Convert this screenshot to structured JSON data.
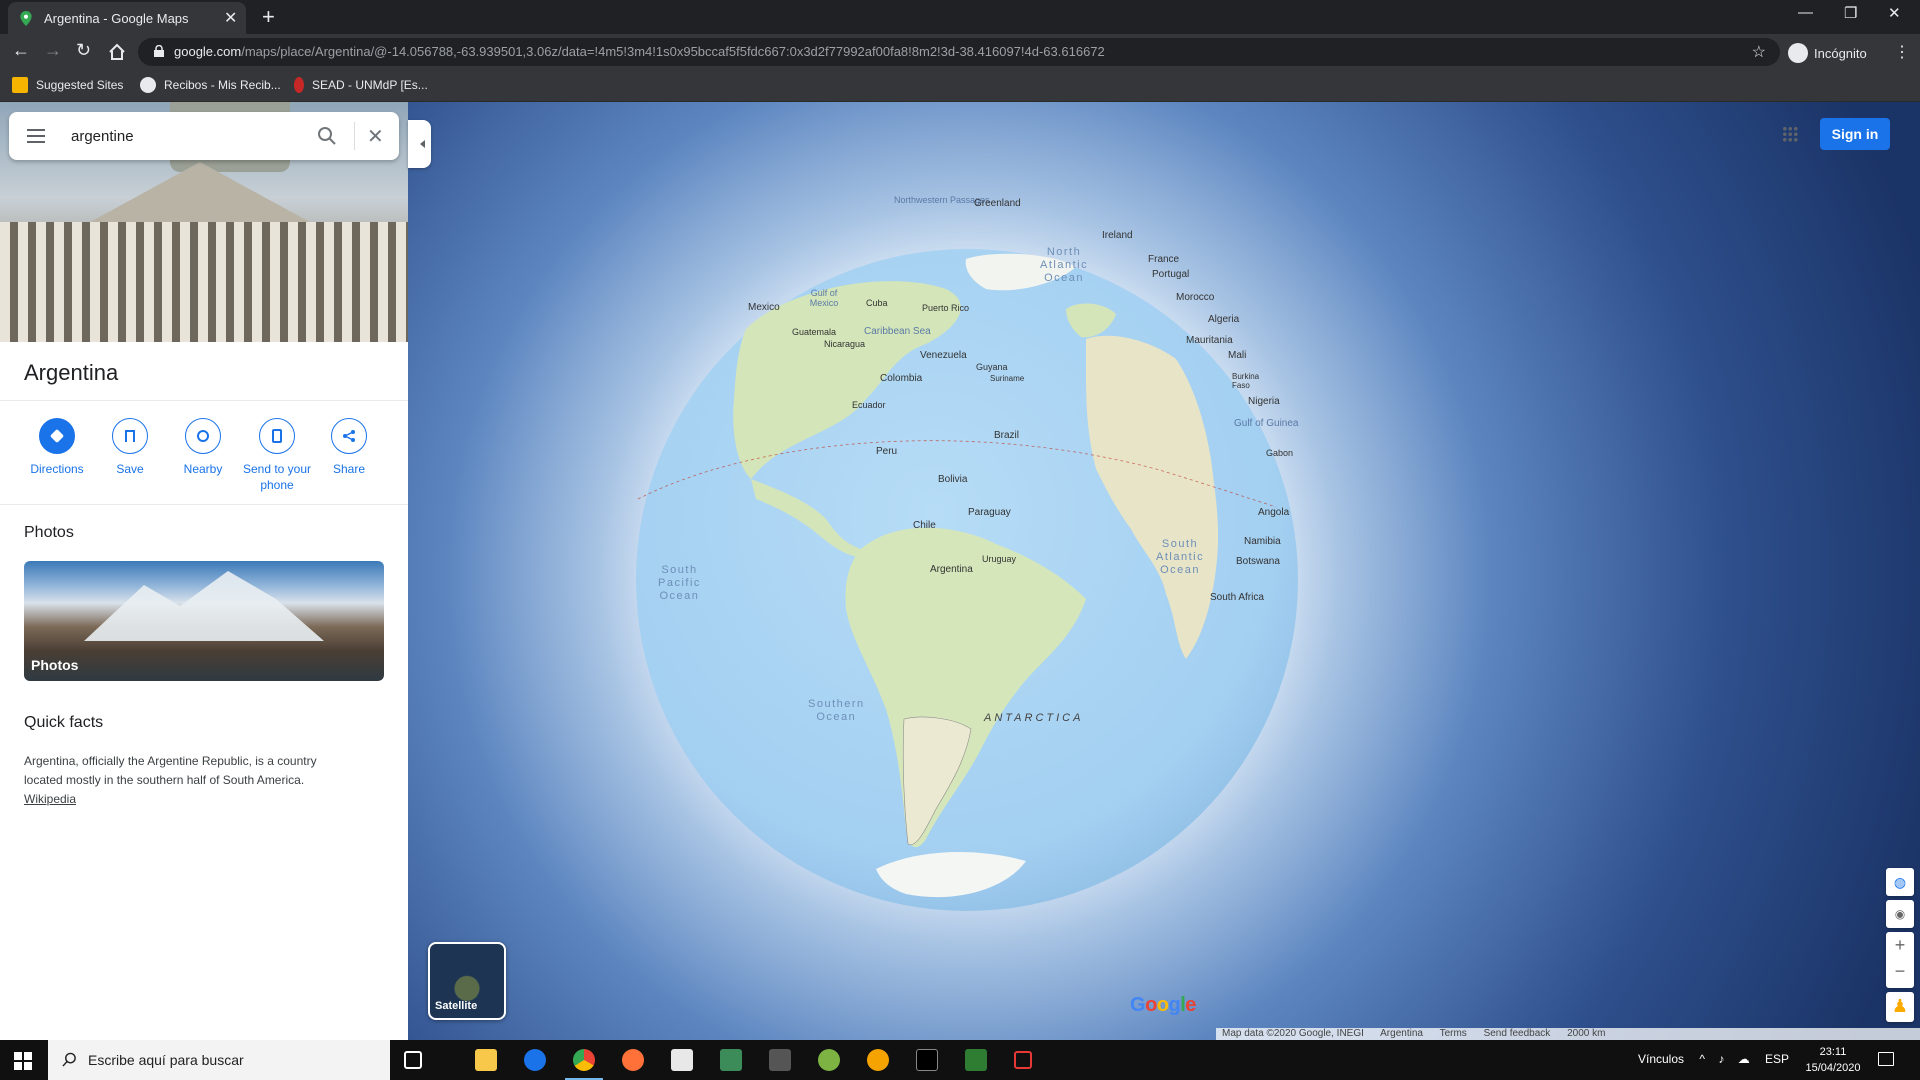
{
  "browser": {
    "tab_title": "Argentina - Google Maps",
    "url_host": "google.com",
    "url_path": "/maps/place/Argentina/@-14.056788,-63.939501,3.06z/data=!4m5!3m4!1s0x95bccaf5f5fdc667:0x3d2f77992af00fa8!8m2!3d-38.416097!4d-63.616672",
    "profile_label": "Incógnito",
    "bookmarks": [
      "Suggested Sites",
      "Recibos - Mis Recib...",
      "SEAD - UNMdP [Es..."
    ]
  },
  "search": {
    "value": "argentine"
  },
  "place": {
    "title": "Argentina",
    "actions": [
      {
        "label": "Directions",
        "icon": "directions-icon"
      },
      {
        "label": "Save",
        "icon": "bookmark-icon"
      },
      {
        "label": "Nearby",
        "icon": "nearby-icon"
      },
      {
        "label": "Send to your phone",
        "icon": "send-to-phone-icon"
      },
      {
        "label": "Share",
        "icon": "share-icon"
      }
    ],
    "photos_heading": "Photos",
    "photo_label": "Photos",
    "quick_facts_heading": "Quick facts",
    "quick_facts_text": "Argentina, officially the Argentine Republic, is a country located mostly in the southern half of South America.",
    "quick_facts_link": "Wikipedia"
  },
  "map": {
    "signin_label": "Sign in",
    "layer_label": "Satellite",
    "google_logo": "Google",
    "attribution": [
      "Map data ©2020 Google, INEGI",
      "Argentina",
      "Terms",
      "Send feedback",
      "2000 km"
    ],
    "labels": [
      "Northwestern Passages",
      "Greenland",
      "Ireland",
      "France",
      "Portugal",
      "Morocco",
      "Algeria",
      "Mauritania",
      "Mali",
      "Burkina Faso",
      "Nigeria",
      "Gulf of Guinea",
      "Gabon",
      "Angola",
      "Namibia",
      "Botswana",
      "South Africa",
      "Mexico",
      "Gulf of Mexico",
      "Cuba",
      "Puerto Rico",
      "Guatemala",
      "Caribbean Sea",
      "Nicaragua",
      "Venezuela",
      "Guyana",
      "Suriname",
      "Colombia",
      "Ecuador",
      "Brazil",
      "Peru",
      "Bolivia",
      "Paraguay",
      "Chile",
      "Uruguay",
      "Argentina",
      "ANTARCTICA"
    ],
    "oceans": [
      "North\nAtlantic\nOcean",
      "South\nAtlantic\nOcean",
      "South\nPacific\nOcean",
      "Southern\nOcean"
    ]
  },
  "taskbar": {
    "search_placeholder": "Escribe aquí para buscar",
    "tray_text": "Vínculos",
    "lang": "ESP",
    "time": "23:11",
    "date": "15/04/2020"
  },
  "colors": {
    "accent": "#1a73e8",
    "ocean": "#a7d0f2",
    "land": "#cfe3b5"
  }
}
